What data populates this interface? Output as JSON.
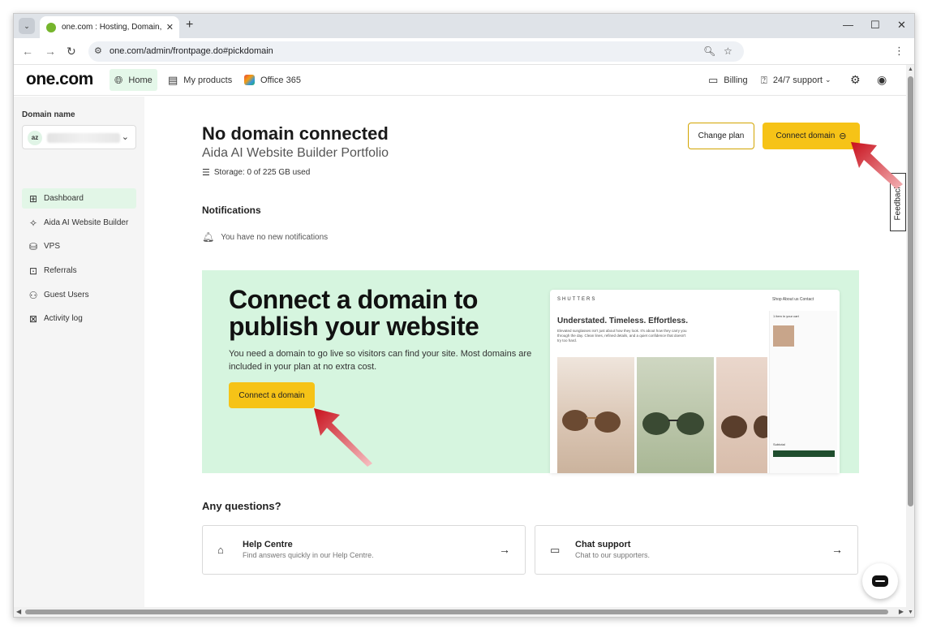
{
  "browser": {
    "tab_title": "one.com : Hosting, Domain, Em",
    "url": "one.com/admin/frontpage.do#pickdomain"
  },
  "header": {
    "logo": "one.com",
    "nav": [
      {
        "label": "Home",
        "icon": "globe-icon"
      },
      {
        "label": "My products",
        "icon": "products-icon"
      },
      {
        "label": "Office 365",
        "icon": "office-icon"
      }
    ],
    "billing": "Billing",
    "support": "24/7 support"
  },
  "sidebar": {
    "domain_label": "Domain name",
    "domain_initials": "az",
    "items": [
      {
        "label": "Dashboard",
        "icon": "dashboard-icon"
      },
      {
        "label": "Aida AI Website Builder",
        "icon": "sparkle-icon"
      },
      {
        "label": "VPS",
        "icon": "database-icon"
      },
      {
        "label": "Referrals",
        "icon": "ticket-icon"
      },
      {
        "label": "Guest Users",
        "icon": "users-icon"
      },
      {
        "label": "Activity log",
        "icon": "activity-icon"
      }
    ]
  },
  "main": {
    "title": "No domain connected",
    "subtitle": "Aida AI Website Builder Portfolio",
    "storage": "Storage: 0 of 225 GB used",
    "change_plan": "Change plan",
    "connect_domain": "Connect domain",
    "notifications_heading": "Notifications",
    "notifications_empty": "You have no new notifications",
    "banner": {
      "title": "Connect a domain to publish your website",
      "text": "You need a domain to go live so visitors can find your site. Most domains are included in your plan at no extra cost.",
      "button": "Connect a domain",
      "preview": {
        "brand": "SHUTTERS",
        "nav": "Shop   About us   Contact",
        "headline": "Understated. Timeless. Effortless.",
        "description": "Elevated sunglasses isn't just about how they look. It's about how they carry you through the day. Clean lines, refined details, and a quiet confidence that doesn't try too hard.",
        "cart_title": "1 item in your cart",
        "subtotal": "Subtotal"
      }
    },
    "questions_heading": "Any questions?",
    "cards": [
      {
        "title": "Help Centre",
        "subtitle": "Find answers quickly in our Help Centre.",
        "icon": "help-icon"
      },
      {
        "title": "Chat support",
        "subtitle": "Chat to our supporters.",
        "icon": "chat-icon"
      }
    ]
  },
  "feedback": "Feedback",
  "colors": {
    "accent_yellow": "#f6c317",
    "banner_green": "#d6f5df",
    "nav_active": "#e4f7e9",
    "annotation_red": "#d0202a"
  }
}
